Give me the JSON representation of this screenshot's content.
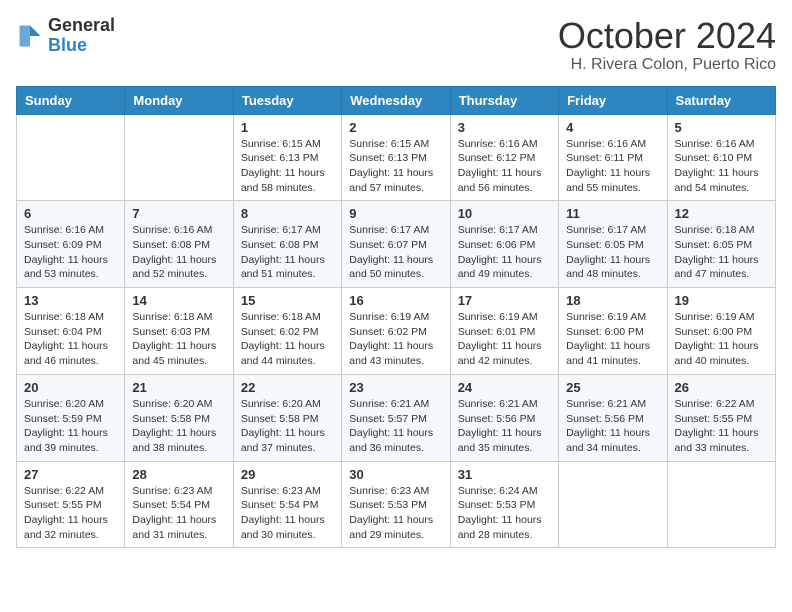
{
  "logo": {
    "general": "General",
    "blue": "Blue"
  },
  "title": "October 2024",
  "location": "H. Rivera Colon, Puerto Rico",
  "days_of_week": [
    "Sunday",
    "Monday",
    "Tuesday",
    "Wednesday",
    "Thursday",
    "Friday",
    "Saturday"
  ],
  "weeks": [
    [
      {
        "day": "",
        "info": ""
      },
      {
        "day": "",
        "info": ""
      },
      {
        "day": "1",
        "info": "Sunrise: 6:15 AM\nSunset: 6:13 PM\nDaylight: 11 hours and 58 minutes."
      },
      {
        "day": "2",
        "info": "Sunrise: 6:15 AM\nSunset: 6:13 PM\nDaylight: 11 hours and 57 minutes."
      },
      {
        "day": "3",
        "info": "Sunrise: 6:16 AM\nSunset: 6:12 PM\nDaylight: 11 hours and 56 minutes."
      },
      {
        "day": "4",
        "info": "Sunrise: 6:16 AM\nSunset: 6:11 PM\nDaylight: 11 hours and 55 minutes."
      },
      {
        "day": "5",
        "info": "Sunrise: 6:16 AM\nSunset: 6:10 PM\nDaylight: 11 hours and 54 minutes."
      }
    ],
    [
      {
        "day": "6",
        "info": "Sunrise: 6:16 AM\nSunset: 6:09 PM\nDaylight: 11 hours and 53 minutes."
      },
      {
        "day": "7",
        "info": "Sunrise: 6:16 AM\nSunset: 6:08 PM\nDaylight: 11 hours and 52 minutes."
      },
      {
        "day": "8",
        "info": "Sunrise: 6:17 AM\nSunset: 6:08 PM\nDaylight: 11 hours and 51 minutes."
      },
      {
        "day": "9",
        "info": "Sunrise: 6:17 AM\nSunset: 6:07 PM\nDaylight: 11 hours and 50 minutes."
      },
      {
        "day": "10",
        "info": "Sunrise: 6:17 AM\nSunset: 6:06 PM\nDaylight: 11 hours and 49 minutes."
      },
      {
        "day": "11",
        "info": "Sunrise: 6:17 AM\nSunset: 6:05 PM\nDaylight: 11 hours and 48 minutes."
      },
      {
        "day": "12",
        "info": "Sunrise: 6:18 AM\nSunset: 6:05 PM\nDaylight: 11 hours and 47 minutes."
      }
    ],
    [
      {
        "day": "13",
        "info": "Sunrise: 6:18 AM\nSunset: 6:04 PM\nDaylight: 11 hours and 46 minutes."
      },
      {
        "day": "14",
        "info": "Sunrise: 6:18 AM\nSunset: 6:03 PM\nDaylight: 11 hours and 45 minutes."
      },
      {
        "day": "15",
        "info": "Sunrise: 6:18 AM\nSunset: 6:02 PM\nDaylight: 11 hours and 44 minutes."
      },
      {
        "day": "16",
        "info": "Sunrise: 6:19 AM\nSunset: 6:02 PM\nDaylight: 11 hours and 43 minutes."
      },
      {
        "day": "17",
        "info": "Sunrise: 6:19 AM\nSunset: 6:01 PM\nDaylight: 11 hours and 42 minutes."
      },
      {
        "day": "18",
        "info": "Sunrise: 6:19 AM\nSunset: 6:00 PM\nDaylight: 11 hours and 41 minutes."
      },
      {
        "day": "19",
        "info": "Sunrise: 6:19 AM\nSunset: 6:00 PM\nDaylight: 11 hours and 40 minutes."
      }
    ],
    [
      {
        "day": "20",
        "info": "Sunrise: 6:20 AM\nSunset: 5:59 PM\nDaylight: 11 hours and 39 minutes."
      },
      {
        "day": "21",
        "info": "Sunrise: 6:20 AM\nSunset: 5:58 PM\nDaylight: 11 hours and 38 minutes."
      },
      {
        "day": "22",
        "info": "Sunrise: 6:20 AM\nSunset: 5:58 PM\nDaylight: 11 hours and 37 minutes."
      },
      {
        "day": "23",
        "info": "Sunrise: 6:21 AM\nSunset: 5:57 PM\nDaylight: 11 hours and 36 minutes."
      },
      {
        "day": "24",
        "info": "Sunrise: 6:21 AM\nSunset: 5:56 PM\nDaylight: 11 hours and 35 minutes."
      },
      {
        "day": "25",
        "info": "Sunrise: 6:21 AM\nSunset: 5:56 PM\nDaylight: 11 hours and 34 minutes."
      },
      {
        "day": "26",
        "info": "Sunrise: 6:22 AM\nSunset: 5:55 PM\nDaylight: 11 hours and 33 minutes."
      }
    ],
    [
      {
        "day": "27",
        "info": "Sunrise: 6:22 AM\nSunset: 5:55 PM\nDaylight: 11 hours and 32 minutes."
      },
      {
        "day": "28",
        "info": "Sunrise: 6:23 AM\nSunset: 5:54 PM\nDaylight: 11 hours and 31 minutes."
      },
      {
        "day": "29",
        "info": "Sunrise: 6:23 AM\nSunset: 5:54 PM\nDaylight: 11 hours and 30 minutes."
      },
      {
        "day": "30",
        "info": "Sunrise: 6:23 AM\nSunset: 5:53 PM\nDaylight: 11 hours and 29 minutes."
      },
      {
        "day": "31",
        "info": "Sunrise: 6:24 AM\nSunset: 5:53 PM\nDaylight: 11 hours and 28 minutes."
      },
      {
        "day": "",
        "info": ""
      },
      {
        "day": "",
        "info": ""
      }
    ]
  ]
}
